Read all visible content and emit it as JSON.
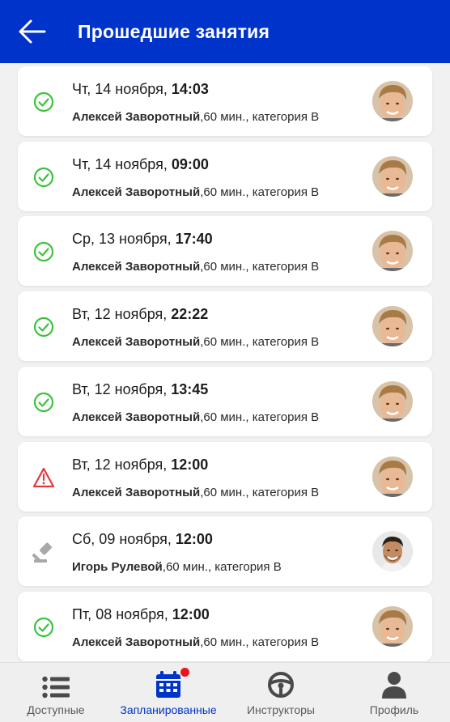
{
  "header": {
    "title": "Прошедшие занятия"
  },
  "lessons": [
    {
      "status": "done",
      "day": "Чт, 14 ноября, ",
      "time": "14:03",
      "instructor": "Алексей Заворотный",
      "details": ",60 мин., категория B",
      "avatar": "avatar-1"
    },
    {
      "status": "done",
      "day": "Чт, 14 ноября, ",
      "time": "09:00",
      "instructor": "Алексей Заворотный",
      "details": ",60 мин., категория B",
      "avatar": "avatar-1"
    },
    {
      "status": "done",
      "day": "Ср, 13 ноября, ",
      "time": "17:40",
      "instructor": "Алексей Заворотный",
      "details": ",60 мин., категория B",
      "avatar": "avatar-1"
    },
    {
      "status": "done",
      "day": "Вт, 12 ноября, ",
      "time": "22:22",
      "instructor": "Алексей Заворотный",
      "details": ",60 мин., категория B",
      "avatar": "avatar-1"
    },
    {
      "status": "done",
      "day": "Вт, 12 ноября, ",
      "time": "13:45",
      "instructor": "Алексей Заворотный",
      "details": ",60 мин., категория B",
      "avatar": "avatar-1"
    },
    {
      "status": "warning",
      "day": "Вт, 12 ноября, ",
      "time": "12:00",
      "instructor": "Алексей Заворотный",
      "details": ",60 мин., категория B",
      "avatar": "avatar-1"
    },
    {
      "status": "disputed",
      "day": "Сб, 09 ноября, ",
      "time": "12:00",
      "instructor": "Игорь Рулевой",
      "details": ",60 мин., категория B",
      "avatar": "avatar-2"
    },
    {
      "status": "done",
      "day": "Пт, 08 ноября, ",
      "time": "12:00",
      "instructor": "Алексей Заворотный",
      "details": ",60 мин., категория B",
      "avatar": "avatar-1"
    }
  ],
  "nav": {
    "items": [
      {
        "label": "Доступные",
        "icon": "list-icon",
        "active": false
      },
      {
        "label": "Запланированные",
        "icon": "calendar-icon",
        "active": true,
        "badge": true
      },
      {
        "label": "Инструкторы",
        "icon": "steering-wheel-icon",
        "active": false
      },
      {
        "label": "Профиль",
        "icon": "user-icon",
        "active": false
      }
    ]
  },
  "colors": {
    "primary": "#0033c9",
    "success": "#3cc23c",
    "warning": "#e23a3a",
    "muted": "#a8a8a8",
    "badge": "#e8141e"
  }
}
